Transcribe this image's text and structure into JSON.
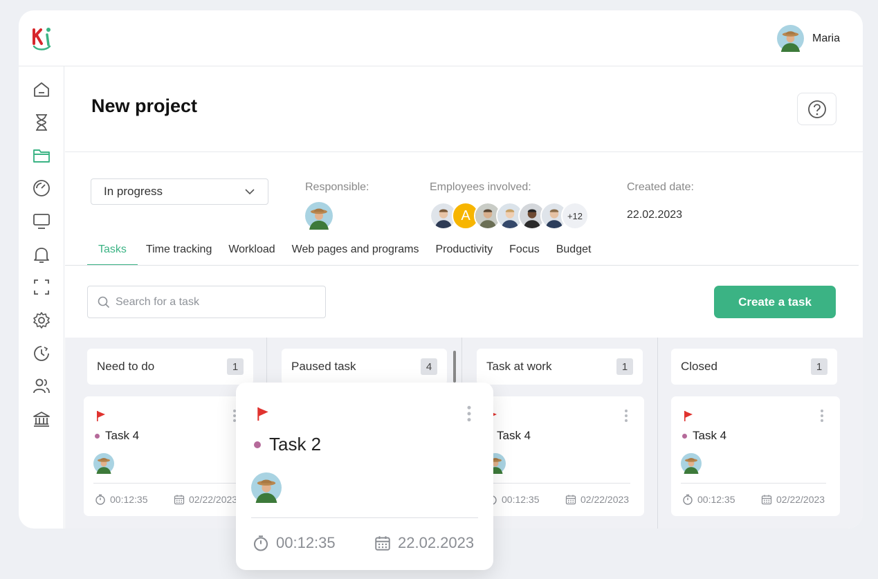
{
  "app": {
    "logo_icon": "ki-logo-icon"
  },
  "user": {
    "name": "Maria"
  },
  "sidebar": {
    "items": [
      {
        "name": "home-icon",
        "active": false
      },
      {
        "name": "hourglass-icon",
        "active": false
      },
      {
        "name": "folder-icon",
        "active": true
      },
      {
        "name": "gauge-icon",
        "active": false
      },
      {
        "name": "monitor-icon",
        "active": false
      },
      {
        "name": "bell-icon",
        "active": false
      },
      {
        "name": "focus-frame-icon",
        "active": false
      },
      {
        "name": "gear-icon",
        "active": false
      },
      {
        "name": "clock-history-icon",
        "active": false
      },
      {
        "name": "users-icon",
        "active": false
      },
      {
        "name": "bank-icon",
        "active": false
      }
    ]
  },
  "header": {
    "title": "New project"
  },
  "project": {
    "status": "In progress",
    "responsible_label": "Responsible:",
    "employees_label": "Employees involved:",
    "employees_more": "+12",
    "employee_initial": "A",
    "created_label": "Created date:",
    "created_date": "22.02.2023"
  },
  "tabs": [
    {
      "label": "Tasks",
      "active": true
    },
    {
      "label": "Time tracking",
      "active": false
    },
    {
      "label": "Workload",
      "active": false
    },
    {
      "label": "Web pages and programs",
      "active": false
    },
    {
      "label": "Productivity",
      "active": false
    },
    {
      "label": "Focus",
      "active": false
    },
    {
      "label": "Budget",
      "active": false
    }
  ],
  "search": {
    "placeholder": "Search for a task"
  },
  "actions": {
    "create_task": "Create a task"
  },
  "columns": [
    {
      "title": "Need to do",
      "count": "1"
    },
    {
      "title": "Paused task",
      "count": "4"
    },
    {
      "title": "Task at work",
      "count": "1"
    },
    {
      "title": "Closed",
      "count": "1"
    }
  ],
  "cards": [
    {
      "title": "Task 4",
      "time": "00:12:35",
      "date": "02/22/2023"
    },
    {
      "title": "Task 4",
      "time": "00:12:35",
      "date": "02/22/2023"
    },
    {
      "title": "Task 4",
      "time": "00:12:35",
      "date": "02/22/2023"
    }
  ],
  "popup": {
    "title": "Task 2",
    "time": "00:12:35",
    "date": "22.02.2023"
  },
  "colors": {
    "accent": "#3bb384",
    "flag": "#e0332f",
    "dot": "#b56a9a",
    "logo_red": "#d7262b",
    "logo_green": "#3bb384"
  }
}
